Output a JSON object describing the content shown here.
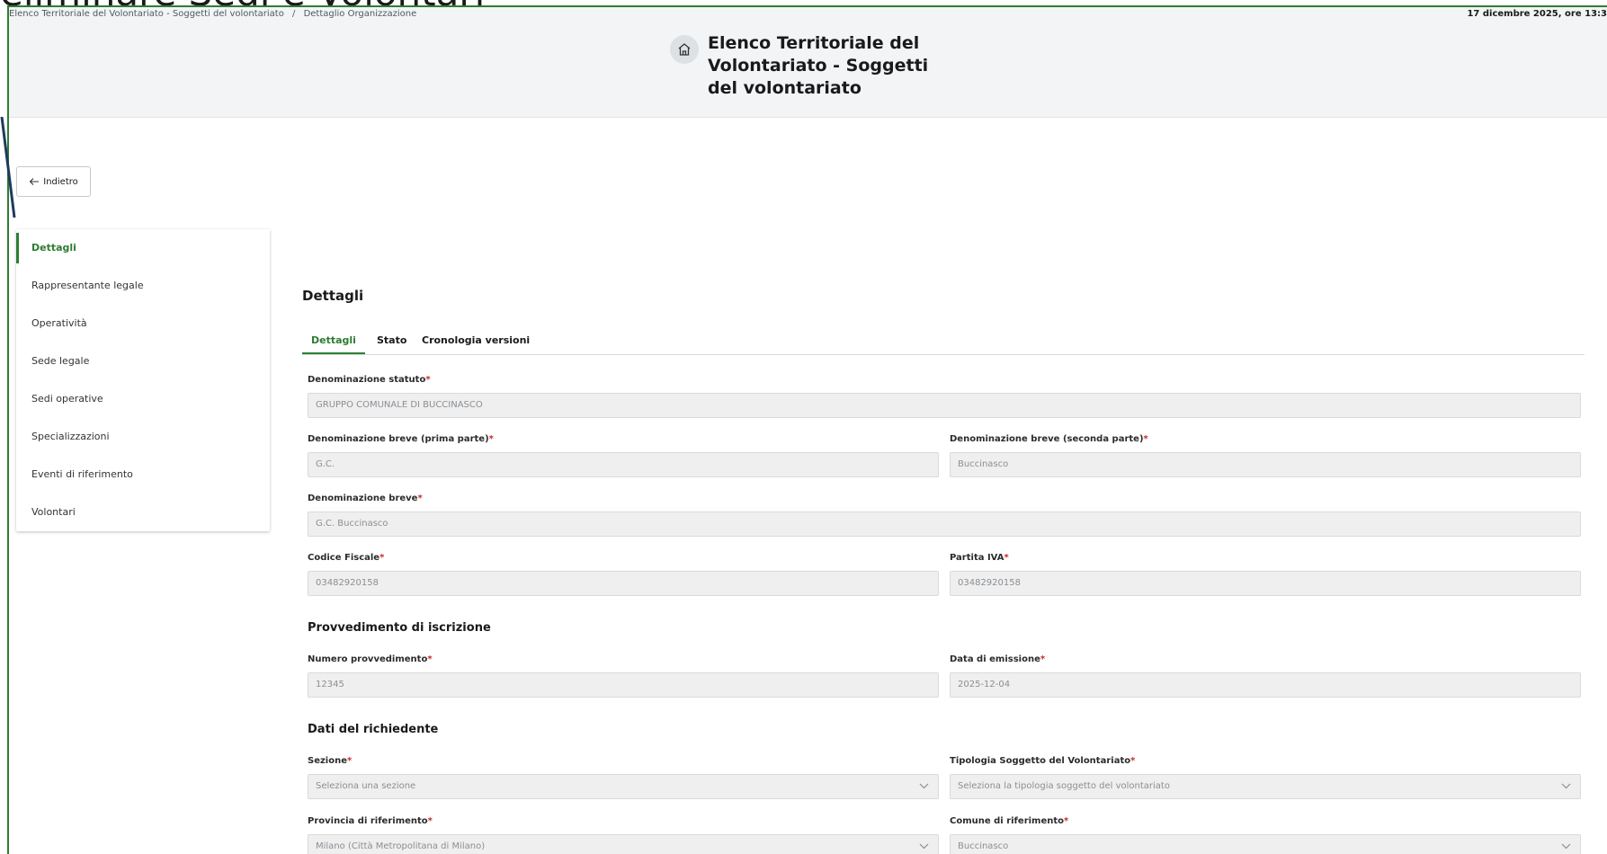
{
  "overlay_text": "eliminare Sedi e Volontari",
  "breadcrumb": {
    "items": [
      "Elenco Territoriale del Volontariato - Soggetti del volontariato",
      "/",
      "Dettaglio Organizzazione"
    ],
    "datetime": "17 dicembre 2025, ore 13:3"
  },
  "header": {
    "app_title": "Elenco Territoriale del Volontariato - Soggetti del volontariato",
    "home_icon": "home-icon"
  },
  "back_button": {
    "label": "Indietro",
    "icon": "arrow-left-icon"
  },
  "sidebar": {
    "items": [
      {
        "label": "Dettagli",
        "active": true
      },
      {
        "label": "Rappresentante legale"
      },
      {
        "label": "Operatività"
      },
      {
        "label": "Sede legale"
      },
      {
        "label": "Sedi operative"
      },
      {
        "label": "Specializzazioni"
      },
      {
        "label": "Eventi di riferimento"
      },
      {
        "label": "Volontari"
      }
    ]
  },
  "main": {
    "title": "Dettagli",
    "tabs": [
      {
        "label": "Dettagli",
        "active": true
      },
      {
        "label": "Stato"
      },
      {
        "label": "Cronologia versioni"
      }
    ],
    "fields": {
      "denominazione_statuto": {
        "label": "Denominazione statuto",
        "value": "GRUPPO COMUNALE DI BUCCINASCO"
      },
      "den_breve_prima": {
        "label": "Denominazione breve (prima parte)",
        "value": "G.C."
      },
      "den_breve_seconda": {
        "label": "Denominazione breve (seconda parte)",
        "value": "Buccinasco"
      },
      "den_breve": {
        "label": "Denominazione breve",
        "value": "G.C. Buccinasco"
      },
      "codice_fiscale": {
        "label": "Codice Fiscale",
        "value": "03482920158"
      },
      "partita_iva": {
        "label": "Partita IVA",
        "value": "03482920158"
      },
      "numero_provvedimento": {
        "label": "Numero provvedimento",
        "value": "12345"
      },
      "data_emissione": {
        "label": "Data di emissione",
        "value": "2025-12-04"
      },
      "sezione": {
        "label": "Sezione",
        "placeholder": "Seleziona una sezione"
      },
      "tipologia": {
        "label": "Tipologia Soggetto del Volontariato",
        "placeholder": "Seleziona la tipologia soggetto del volontariato"
      },
      "provincia": {
        "label": "Provincia di riferimento",
        "value": "Milano (Città Metropolitana di Milano)"
      },
      "comune": {
        "label": "Comune di riferimento",
        "value": "Buccinasco"
      }
    },
    "subsections": {
      "provvedimento": "Provvedimento di iscrizione",
      "richiedente": "Dati del richiedente"
    },
    "required_mark": "*"
  },
  "colors": {
    "accent": "#2e7d32",
    "required": "#c62828"
  }
}
